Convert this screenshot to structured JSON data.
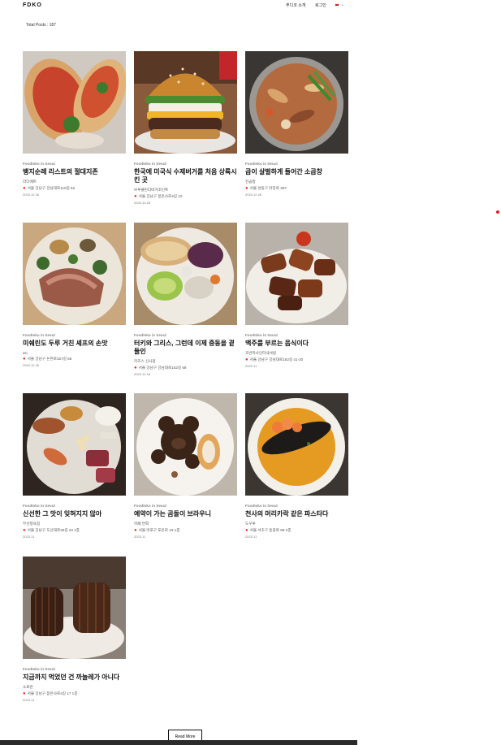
{
  "header": {
    "logo": "FDKO",
    "nav_intro": "푸디코 소개",
    "nav_login": "로그인",
    "lang_caret": "⌄"
  },
  "total_posts": "Total Posts : 187",
  "posts": [
    {
      "category": "FoodInko in Seoul",
      "title": "뱅지순례 리스트의 절대지존",
      "place": "라디에트",
      "address": "서울 강남구 강남대로110길 62",
      "date": "2023.12.26"
    },
    {
      "category": "FoodInko in Seoul",
      "title": "한국에 미국식 수제버거를 처음 상륙시킨 곳",
      "place": "브루클린더버거조인트",
      "address": "서울 강남구 봉은사로4길 10",
      "date": "2023.12.26"
    },
    {
      "category": "FoodInko in Seoul",
      "title": "곱이 살벌하게 들어간 소곱창",
      "place": "진곱창",
      "address": "서울 성동구 마장로 397",
      "date": "2023.12.26"
    },
    {
      "category": "FoodInko in Seoul",
      "title": "미쉐린도 두루 거친 셰프의 손맛",
      "place": "ssi",
      "address": "서울 강남구 논현로157길 55",
      "date": "2023.12.26"
    },
    {
      "category": "FoodInko in Seoul",
      "title": "터키와 그리스, 그런데 이제 중동을 곁들인",
      "place": "카즈스 신사점",
      "address": "서울 강남구 강남대로152길 69",
      "date": "2023.12.18"
    },
    {
      "category": "FoodInko in Seoul",
      "title": "맥주를 부르는 음식이다",
      "place": "호반카사인터내셔널",
      "address": "서울 강남구 강남대로162길 41-20",
      "date": "2023.11"
    },
    {
      "category": "FoodInko in Seoul",
      "title": "신선한 그 맛이 잊혀지지 않아",
      "place": "부산정육점",
      "address": "서울 강남구 도산대로30길 23 1층",
      "date": "2023.11"
    },
    {
      "category": "FoodInko in Seoul",
      "title": "예약이 가는 곰돌이 브라우니",
      "place": "카페 연희",
      "address": "서울 마포구 포은로 19 1층",
      "date": "2023.11"
    },
    {
      "category": "FoodInko in Seoul",
      "title": "천사의 머리카락 같은 파스타다",
      "place": "도우루",
      "address": "서울 서초구 동광로 99 2층",
      "date": "2023.11"
    },
    {
      "category": "FoodInko in Seoul",
      "title": "지금까지 먹었던 건 까눌레가 아니다",
      "place": "소프란",
      "address": "서울 강남구 봉은사로4길 17 1층",
      "date": "2023.11"
    }
  ],
  "read_more": "Read More",
  "colors": {
    "accent_red": "#e0332b",
    "footer": "#2b2b2b"
  }
}
